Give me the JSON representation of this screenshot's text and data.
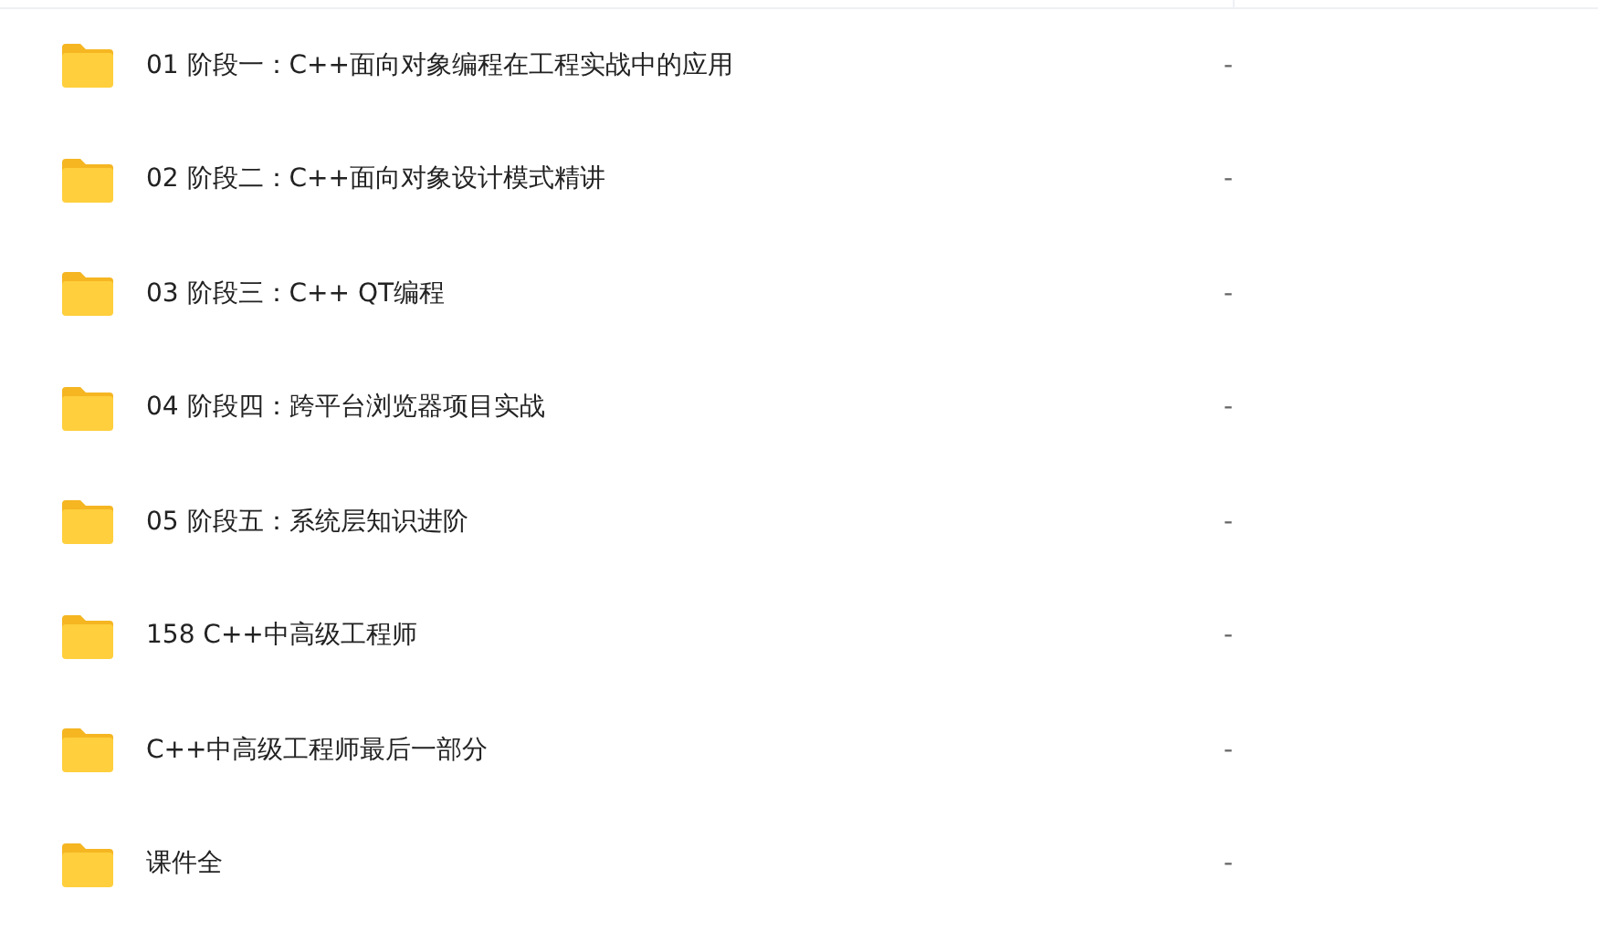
{
  "files": [
    {
      "name": "01 阶段一：C++面向对象编程在工程实战中的应用",
      "size": "-"
    },
    {
      "name": "02 阶段二：C++面向对象设计模式精讲",
      "size": "-"
    },
    {
      "name": "03 阶段三：C++ QT编程",
      "size": "-"
    },
    {
      "name": "04 阶段四：跨平台浏览器项目实战",
      "size": "-"
    },
    {
      "name": "05 阶段五：系统层知识进阶",
      "size": "-"
    },
    {
      "name": "158 C++中高级工程师",
      "size": "-"
    },
    {
      "name": "C++中高级工程师最后一部分",
      "size": "-"
    },
    {
      "name": "课件全",
      "size": "-"
    }
  ]
}
